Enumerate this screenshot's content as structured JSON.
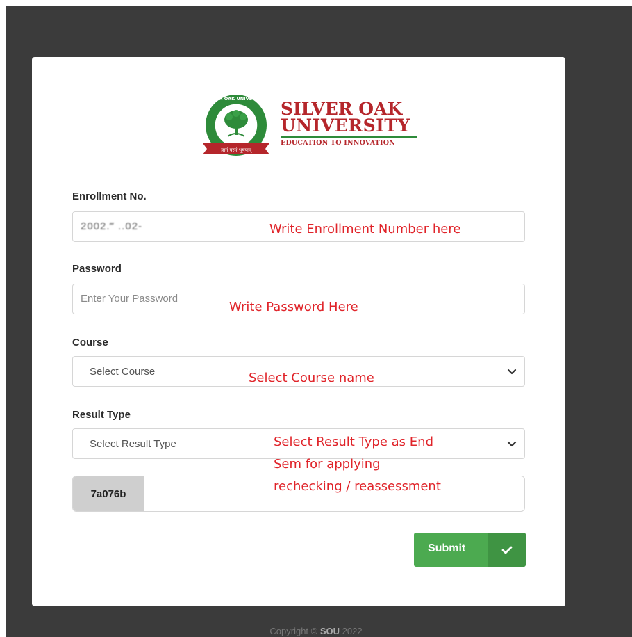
{
  "logo": {
    "seal_text": "SILVER OAK UNIVERSITY",
    "banner_text": "ज्ञानं परमं भूषणम्",
    "line1": "SILVER OAK",
    "line2": "UNIVERSITY",
    "tagline": "EDUCATION TO INNOVATION"
  },
  "form": {
    "enrollment": {
      "label": "Enrollment No.",
      "value": "2002.‴  ..02-",
      "annotation": "Write Enrollment Number here"
    },
    "password": {
      "label": "Password",
      "placeholder": "Enter Your Password",
      "annotation": "Write Password Here"
    },
    "course": {
      "label": "Course",
      "selected": "Select Course",
      "annotation": "Select Course name"
    },
    "result_type": {
      "label": "Result Type",
      "selected": "Select Result Type",
      "annotation_line1": "Select Result Type as End",
      "annotation_line2": "Sem for applying",
      "annotation_line3": "rechecking / reassessment"
    },
    "captcha": {
      "code": "7a076b",
      "value": ""
    },
    "submit_label": "Submit"
  },
  "footer": {
    "prefix": "Copyright ©",
    "brand": "SOU",
    "year": "2022"
  },
  "colors": {
    "backdrop": "#3b3b3b",
    "annotation": "#e0242a",
    "submit": "#4caa50",
    "brand_red": "#b5262b",
    "brand_green": "#2e8b3a"
  }
}
